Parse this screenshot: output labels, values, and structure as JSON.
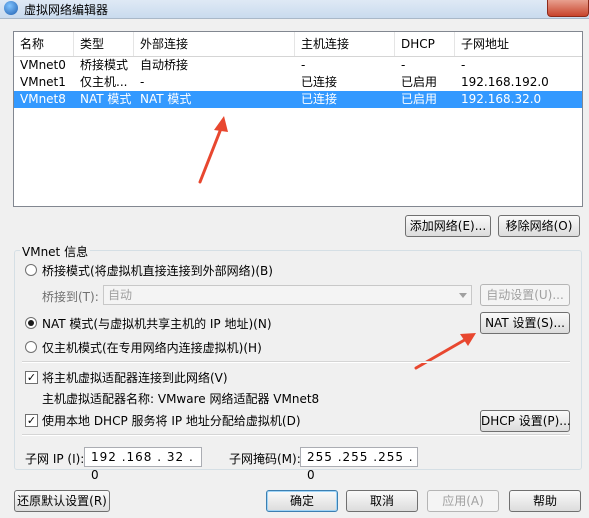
{
  "window": {
    "title": "虚拟网络编辑器"
  },
  "table": {
    "columns": [
      "名称",
      "类型",
      "外部连接",
      "主机连接",
      "DHCP",
      "子网地址"
    ],
    "rows": [
      [
        "VMnet0",
        "桥接模式",
        "自动桥接",
        "-",
        "-",
        "-"
      ],
      [
        "VMnet1",
        "仅主机...",
        "-",
        "已连接",
        "已启用",
        "192.168.192.0"
      ],
      [
        "VMnet8",
        "NAT 模式",
        "NAT 模式",
        "已连接",
        "已启用",
        "192.168.32.0"
      ]
    ],
    "selected_index": 2
  },
  "buttons": {
    "add_network": "添加网络(E)...",
    "remove_network": "移除网络(O)",
    "auto_settings": "自动设置(U)...",
    "nat_settings": "NAT 设置(S)...",
    "dhcp_settings": "DHCP 设置(P)...",
    "restore_defaults": "还原默认设置(R)",
    "ok": "确定",
    "cancel": "取消",
    "apply": "应用(A)",
    "help": "帮助"
  },
  "vmnet_info": {
    "group_label": "VMnet 信息",
    "bridged_option": "桥接模式(将虚拟机直接连接到外部网络)(B)",
    "bridge_to_label": "桥接到(T):",
    "bridge_to_value": "自动",
    "nat_option": "NAT 模式(与虚拟机共享主机的 IP 地址)(N)",
    "host_only_option": "仅主机模式(在专用网络内连接虚拟机)(H)",
    "selected_mode": "nat",
    "connect_adapter_label": "将主机虚拟适配器连接到此网络(V)",
    "connect_adapter_checked": true,
    "adapter_name_label": "主机虚拟适配器名称: VMware 网络适配器 VMnet8",
    "dhcp_label": "使用本地 DHCP 服务将 IP 地址分配给虚拟机(D)",
    "dhcp_checked": true,
    "subnet_ip_label": "子网 IP (I):",
    "subnet_ip_value": "192 .168 . 32 . 0",
    "subnet_mask_label": "子网掩码(M):",
    "subnet_mask_value": "255 .255 .255 . 0"
  },
  "annotations": {
    "arrow_color": "#e8472f"
  }
}
